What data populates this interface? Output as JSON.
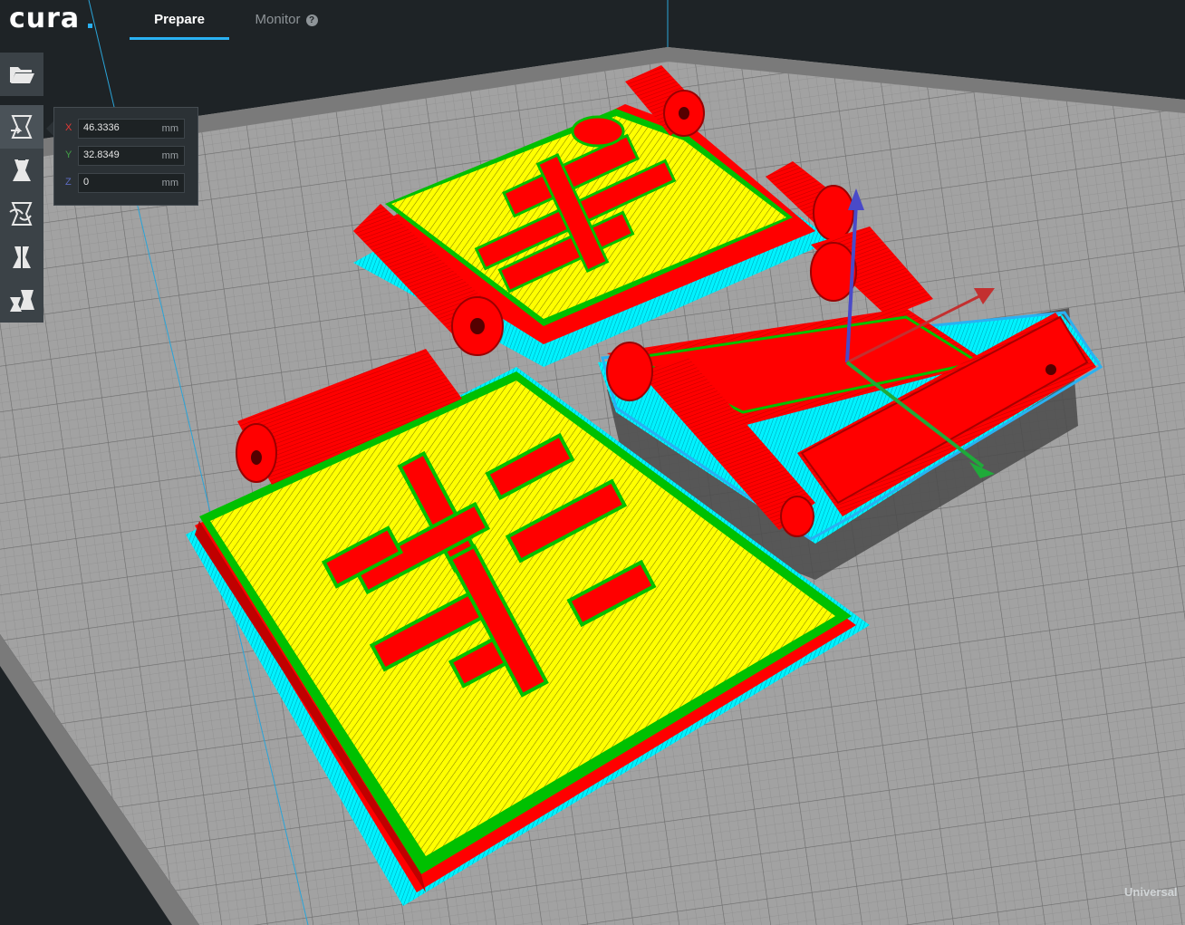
{
  "app": {
    "logo_text": "cura",
    "tabs": [
      {
        "label": "Prepare",
        "active": true
      },
      {
        "label": "Monitor",
        "active": false
      }
    ],
    "help_icon_glyph": "?",
    "brand_footer": "Universal"
  },
  "toolbar": {
    "items": [
      {
        "name": "open-file",
        "icon": "folder-open-icon"
      },
      {
        "name": "translate",
        "icon": "translate-icon",
        "active": true
      },
      {
        "name": "scale",
        "icon": "scale-icon"
      },
      {
        "name": "rotate",
        "icon": "rotate-icon"
      },
      {
        "name": "mirror",
        "icon": "mirror-icon"
      },
      {
        "name": "per-object-settings",
        "icon": "per-object-settings-icon"
      }
    ]
  },
  "translate_panel": {
    "x": {
      "label": "X",
      "value": "46.3336",
      "unit": "mm",
      "color": "#e53935"
    },
    "y": {
      "label": "Y",
      "value": "32.8349",
      "unit": "mm",
      "color": "#43a047"
    },
    "z": {
      "label": "Z",
      "value": "0",
      "unit": "mm",
      "color": "#5c6bc0"
    }
  },
  "colors": {
    "background": "#1e2326",
    "build_plate": "#9a9a9a",
    "wall_inner": "#ff0000",
    "wall_outer": "#00c000",
    "skin": "#ffff00",
    "support": "#00ffff",
    "accent": "#2ab1f2",
    "axis_x": "#e53935",
    "axis_y": "#1faa3a",
    "axis_z": "#4a4ac8"
  }
}
